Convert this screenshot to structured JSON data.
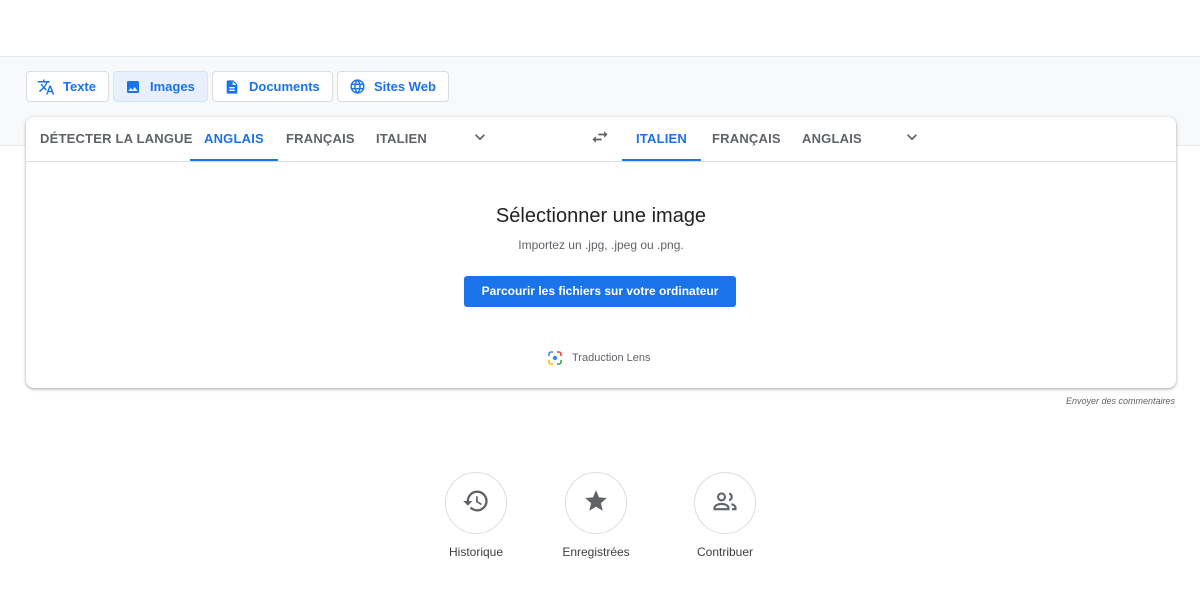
{
  "modes": [
    {
      "label": "Texte",
      "icon": "translate-icon"
    },
    {
      "label": "Images",
      "icon": "image-icon",
      "active": true
    },
    {
      "label": "Documents",
      "icon": "document-icon"
    },
    {
      "label": "Sites Web",
      "icon": "globe-icon"
    }
  ],
  "source_languages": [
    "DÉTECTER LA LANGUE",
    "ANGLAIS",
    "FRANÇAIS",
    "ITALIEN"
  ],
  "source_selected": "ANGLAIS",
  "target_languages": [
    "ITALIEN",
    "FRANÇAIS",
    "ANGLAIS"
  ],
  "target_selected": "ITALIEN",
  "upload": {
    "title": "Sélectionner une image",
    "subtitle": "Importez un .jpg, .jpeg ou .png.",
    "browse_label": "Parcourir les fichiers sur votre ordinateur",
    "lens_label": "Traduction Lens"
  },
  "feedback_label": "Envoyer des commentaires",
  "bottom_actions": [
    {
      "label": "Historique",
      "icon": "history-icon"
    },
    {
      "label": "Enregistrées",
      "icon": "star-icon"
    },
    {
      "label": "Contribuer",
      "icon": "people-icon"
    }
  ],
  "colors": {
    "accent": "#1a73e8",
    "active_bg": "#e8f0fe",
    "text": "#5f6368"
  }
}
